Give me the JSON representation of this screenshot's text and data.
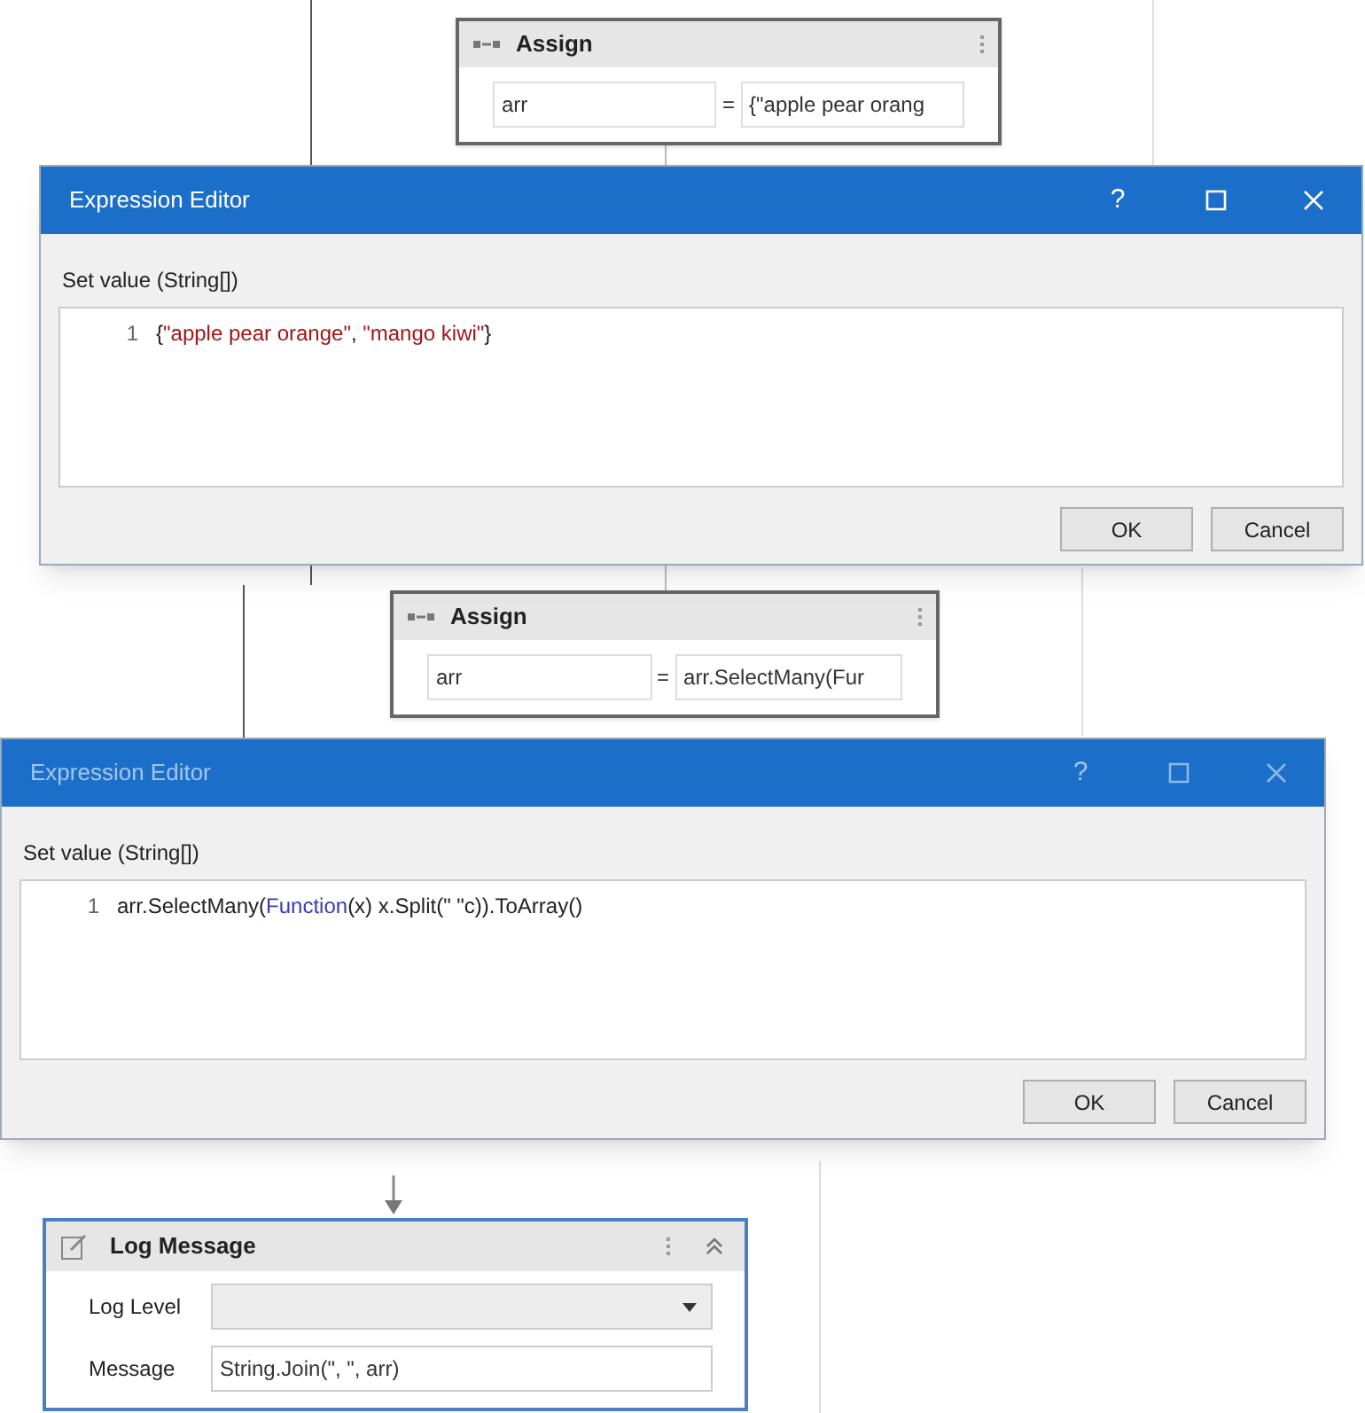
{
  "assign_cards": [
    {
      "title": "Assign",
      "to": "arr",
      "equals": "=",
      "value": "{\"apple pear orang"
    },
    {
      "title": "Assign",
      "to": "arr",
      "equals": "=",
      "value": "arr.SelectMany(Fur"
    }
  ],
  "editors": [
    {
      "title": "Expression Editor",
      "active": true,
      "help": "?",
      "label": "Set value (String[])",
      "line_number": "1",
      "code": [
        {
          "text": "{",
          "kind": "plain"
        },
        {
          "text": "\"apple pear orange\"",
          "kind": "string"
        },
        {
          "text": ", ",
          "kind": "plain"
        },
        {
          "text": "\"mango kiwi\"",
          "kind": "string"
        },
        {
          "text": "}",
          "kind": "plain"
        }
      ],
      "buttons": [
        "OK",
        "Cancel"
      ]
    },
    {
      "title": "Expression Editor",
      "active": false,
      "help": "?",
      "label": "Set value (String[])",
      "line_number": "1",
      "code": [
        {
          "text": "arr.SelectMany(",
          "kind": "plain"
        },
        {
          "text": "Function",
          "kind": "keyword"
        },
        {
          "text": "(x) x.Split(\" \"c)).ToArray()",
          "kind": "plain"
        }
      ],
      "buttons": [
        "OK",
        "Cancel"
      ]
    }
  ],
  "log_message": {
    "title": "Log Message",
    "fields": [
      {
        "label": "Log Level",
        "kind": "dropdown"
      },
      {
        "label": "Message",
        "kind": "text",
        "value": "String.Join(\", \", arr)"
      }
    ]
  }
}
